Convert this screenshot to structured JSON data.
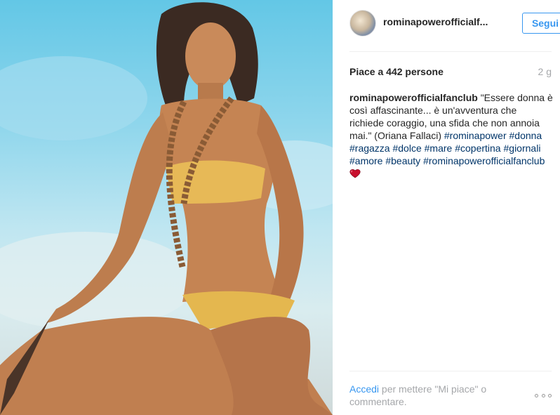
{
  "post": {
    "photo_alt": "",
    "header": {
      "username": "rominapowerofficialf...",
      "follow_label": "Segui"
    },
    "likes_text": "Piace a 442 persone",
    "time_text": "2 g",
    "caption": {
      "author": "rominapowerofficialfanclub",
      "text": " \"Essere donna è così affascinante... è un'avventura che richiede coraggio, una sfida che non annoia mai.\" (Oriana Fallaci) ",
      "hashtags": [
        "#rominapower",
        "#donna",
        "#ragazza",
        "#dolce",
        "#mare",
        "#copertina",
        "#giornali",
        "#amore",
        "#beauty",
        "#rominapowerofficialfanclub"
      ]
    },
    "footer": {
      "login_link": "Accedi",
      "login_text": " per mettere \"Mi piace\" o commentare."
    }
  },
  "colors": {
    "accent": "#3897f0",
    "hashtag": "#003569",
    "muted": "#a5a7aa"
  },
  "icons": {
    "heart": "heart-icon",
    "more": "more-options-icon"
  }
}
